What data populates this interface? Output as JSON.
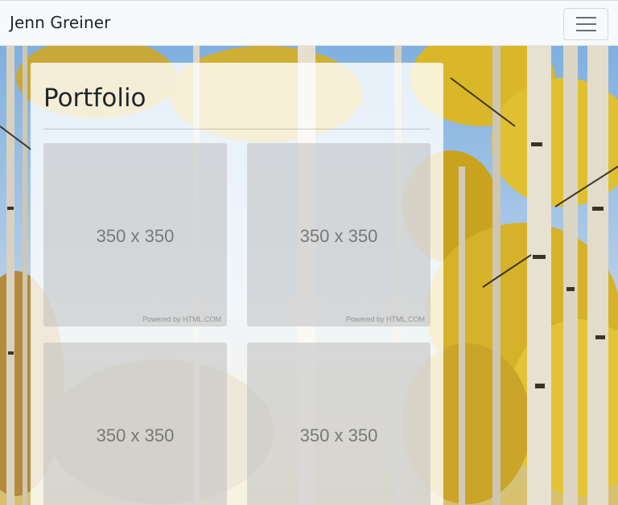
{
  "navbar": {
    "brand": "Jenn Greiner",
    "toggle_icon": "hamburger-menu-icon",
    "background": "#f8f9fa"
  },
  "main": {
    "title": "Portfolio",
    "card_background": "rgba(255,255,255,0.8)",
    "thumbnails": [
      {
        "label": "350 x 350",
        "credit": "Powered by HTML.COM"
      },
      {
        "label": "350 x 350",
        "credit": "Powered by HTML.COM"
      },
      {
        "label": "350 x 350",
        "credit": ""
      },
      {
        "label": "350 x 350",
        "credit": ""
      }
    ]
  }
}
